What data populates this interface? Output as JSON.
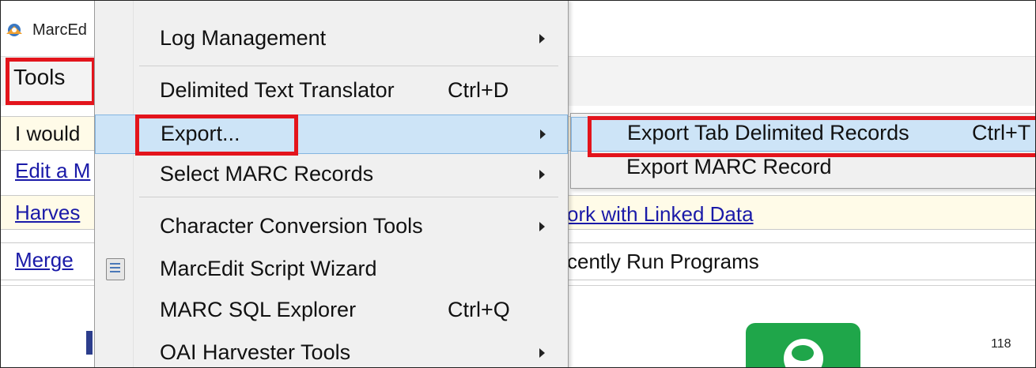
{
  "app": {
    "title": "MarcEd"
  },
  "menubar": {
    "tools_label": "Tools"
  },
  "background_rows": {
    "row1_left": "I would",
    "row2_left": "Edit a M",
    "row3_left": "Harves",
    "row3_right": "ork with Linked Data",
    "row4_left": "Merge",
    "row4_right": "cently Run Programs"
  },
  "tools_menu": {
    "items": [
      {
        "label": "Log Management",
        "shortcut": ""
      },
      {
        "label": "Delimited Text Translator",
        "shortcut": "Ctrl+D"
      },
      {
        "label": "Export...",
        "shortcut": ""
      },
      {
        "label": "Select MARC Records",
        "shortcut": ""
      },
      {
        "label": "Character Conversion Tools",
        "shortcut": ""
      },
      {
        "label": "MarcEdit Script Wizard",
        "shortcut": ""
      },
      {
        "label": "MARC SQL Explorer",
        "shortcut": "Ctrl+Q"
      },
      {
        "label": "OAI Harvester Tools",
        "shortcut": ""
      }
    ]
  },
  "export_submenu": {
    "items": [
      {
        "label": "Export Tab Delimited Records",
        "shortcut": "Ctrl+T"
      },
      {
        "label": "Export MARC Record",
        "shortcut": ""
      }
    ]
  },
  "slide": {
    "page_number": "118"
  },
  "colors": {
    "highlight_box": "#e3141c",
    "menu_active": "#cde4f7",
    "link": "#1a1aa8"
  }
}
